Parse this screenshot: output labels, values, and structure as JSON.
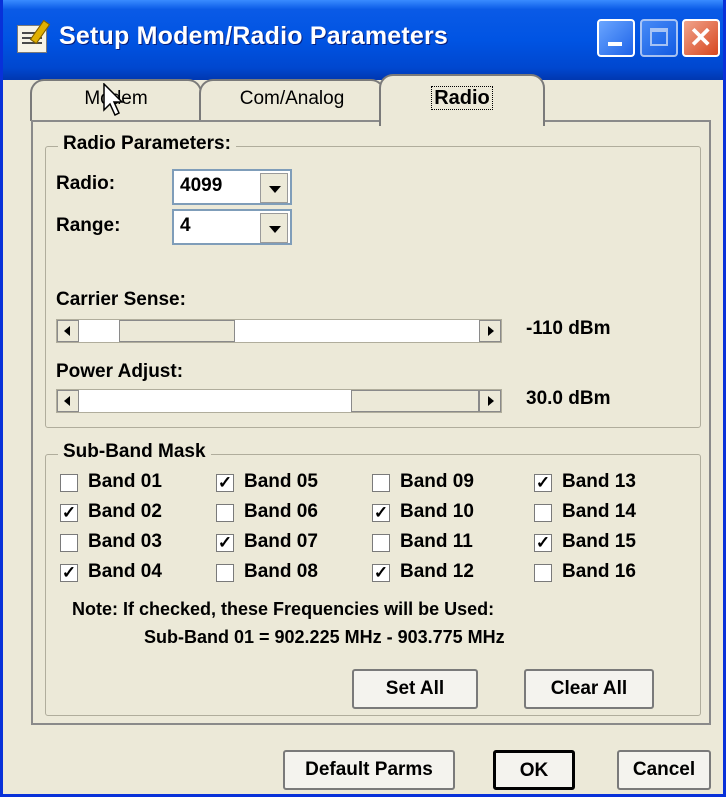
{
  "window": {
    "title": "Setup Modem/Radio Parameters",
    "minimize_label": "_",
    "maximize_label": "□",
    "close_label": "✕"
  },
  "tabs": [
    "Modem",
    "Com/Analog",
    "Radio"
  ],
  "active_tab": "Radio",
  "radio_params": {
    "group_title": "Radio Parameters:",
    "radio_label": "Radio:",
    "radio_value": "4099",
    "range_label": "Range:",
    "range_value": "4",
    "carrier_label": "Carrier Sense:",
    "carrier_value": "-110 dBm",
    "carrier_level": 0.24,
    "power_label": "Power Adjust:",
    "power_value": "30.0 dBm",
    "power_level": 0.68
  },
  "subband": {
    "group_title": "Sub-Band Mask",
    "bands": [
      {
        "label": "Band 01",
        "checked": false
      },
      {
        "label": "Band 02",
        "checked": true
      },
      {
        "label": "Band 03",
        "checked": false
      },
      {
        "label": "Band 04",
        "checked": true
      },
      {
        "label": "Band 05",
        "checked": true
      },
      {
        "label": "Band 06",
        "checked": false
      },
      {
        "label": "Band 07",
        "checked": true
      },
      {
        "label": "Band 08",
        "checked": false
      },
      {
        "label": "Band 09",
        "checked": false
      },
      {
        "label": "Band 10",
        "checked": true
      },
      {
        "label": "Band 11",
        "checked": false
      },
      {
        "label": "Band 12",
        "checked": true
      },
      {
        "label": "Band 13",
        "checked": true
      },
      {
        "label": "Band 14",
        "checked": false
      },
      {
        "label": "Band 15",
        "checked": true
      },
      {
        "label": "Band 16",
        "checked": false
      }
    ],
    "note_line1": "Note: If checked, these Frequencies will be Used:",
    "note_line2": "Sub-Band 01 = 902.225 MHz - 903.775 MHz",
    "set_all_label": "Set All",
    "clear_all_label": "Clear All"
  },
  "footer": {
    "default_parms_label": "Default Parms",
    "ok_label": "OK",
    "cancel_label": "Cancel"
  }
}
